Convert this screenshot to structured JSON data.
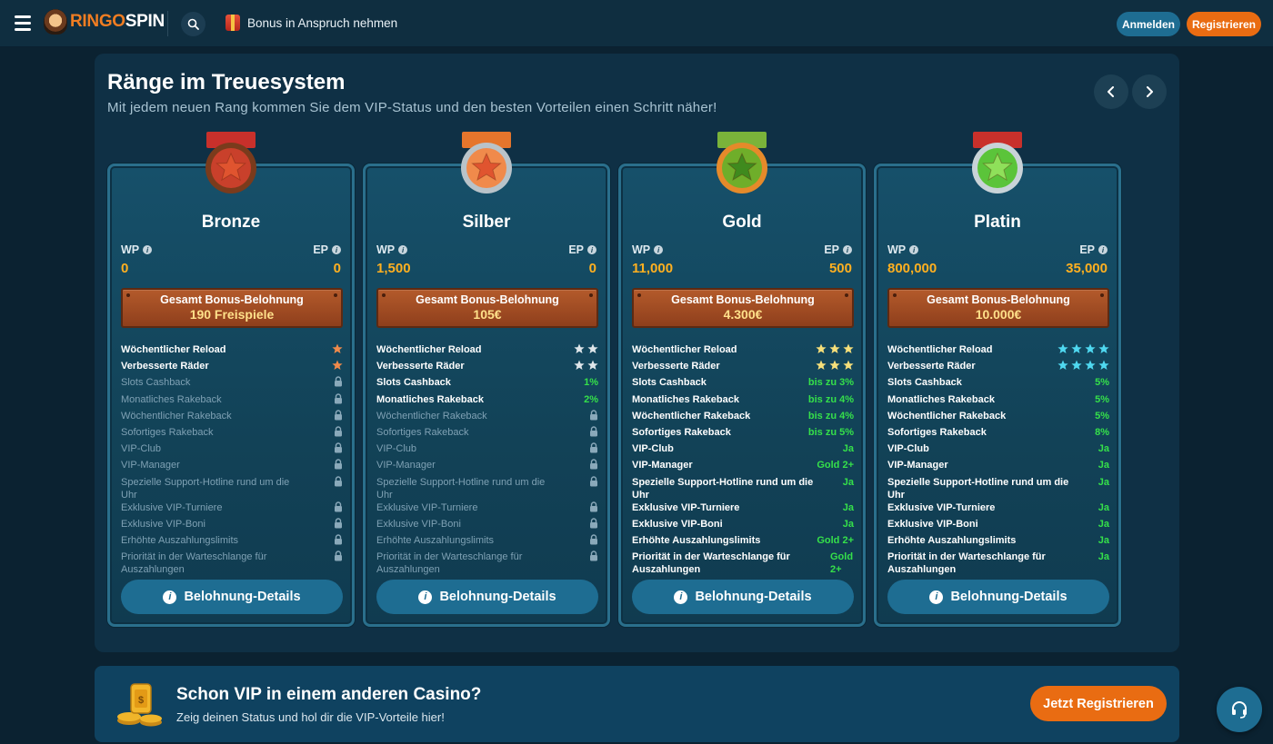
{
  "header": {
    "logo_ringo": "RINGO",
    "logo_spin": "SPIN",
    "bonus_label": "Bonus in Anspruch nehmen",
    "login_label": "Anmelden",
    "register_label": "Registrieren"
  },
  "section": {
    "title": "Ränge im Treuesystem",
    "subtitle": "Mit jedem neuen Rang kommen Sie dem VIP-Status und den besten Vorteilen einen Schritt näher!"
  },
  "cards": [
    {
      "name": "Bronze",
      "wp_label": "WP",
      "ep_label": "EP",
      "wp": "0",
      "ep": "0",
      "reward_title": "Gesamt Bonus-Belohnung",
      "reward_value": "190 Freispiele",
      "medal_color": "#c9402b",
      "star_color": "#f08a4b",
      "features": [
        {
          "name": "Wöchentlicher Reload",
          "stars": 1
        },
        {
          "name": "Verbesserte Räder",
          "stars": 1
        },
        {
          "name": "Slots Cashback",
          "locked": true
        },
        {
          "name": "Monatliches Rakeback",
          "locked": true
        },
        {
          "name": "Wöchentlicher Rakeback",
          "locked": true
        },
        {
          "name": "Sofortiges Rakeback",
          "locked": true
        },
        {
          "name": "VIP-Club",
          "locked": true
        },
        {
          "name": "VIP-Manager",
          "locked": true
        },
        {
          "name": "Spezielle Support-Hotline rund um die Uhr",
          "locked": true
        },
        {
          "name": "Exklusive VIP-Turniere",
          "locked": true
        },
        {
          "name": "Exklusive VIP-Boni",
          "locked": true
        },
        {
          "name": "Erhöhte Auszahlungslimits",
          "locked": true
        },
        {
          "name": "Priorität in der Warteschlange für Auszahlungen",
          "locked": true
        }
      ],
      "details_label": "Belohnung-Details"
    },
    {
      "name": "Silber",
      "wp_label": "WP",
      "ep_label": "EP",
      "wp": "1,500",
      "ep": "0",
      "reward_title": "Gesamt Bonus-Belohnung",
      "reward_value": "105€",
      "medal_color": "#f08a4b",
      "star_color": "#dfe6ea",
      "features": [
        {
          "name": "Wöchentlicher Reload",
          "stars": 2
        },
        {
          "name": "Verbesserte Räder",
          "stars": 2
        },
        {
          "name": "Slots Cashback",
          "value": "1%"
        },
        {
          "name": "Monatliches Rakeback",
          "value": "2%"
        },
        {
          "name": "Wöchentlicher Rakeback",
          "locked": true
        },
        {
          "name": "Sofortiges Rakeback",
          "locked": true
        },
        {
          "name": "VIP-Club",
          "locked": true
        },
        {
          "name": "VIP-Manager",
          "locked": true
        },
        {
          "name": "Spezielle Support-Hotline rund um die Uhr",
          "locked": true
        },
        {
          "name": "Exklusive VIP-Turniere",
          "locked": true
        },
        {
          "name": "Exklusive VIP-Boni",
          "locked": true
        },
        {
          "name": "Erhöhte Auszahlungslimits",
          "locked": true
        },
        {
          "name": "Priorität in der Warteschlange für Auszahlungen",
          "locked": true
        }
      ],
      "details_label": "Belohnung-Details"
    },
    {
      "name": "Gold",
      "wp_label": "WP",
      "ep_label": "EP",
      "wp": "11,000",
      "ep": "500",
      "reward_title": "Gesamt Bonus-Belohnung",
      "reward_value": "4.300€",
      "medal_color": "#6fae2a",
      "star_color": "#f6df7a",
      "features": [
        {
          "name": "Wöchentlicher Reload",
          "stars": 3
        },
        {
          "name": "Verbesserte Räder",
          "stars": 3
        },
        {
          "name": "Slots Cashback",
          "value": "bis zu 3%"
        },
        {
          "name": "Monatliches Rakeback",
          "value": "bis zu 4%"
        },
        {
          "name": "Wöchentlicher Rakeback",
          "value": "bis zu 4%"
        },
        {
          "name": "Sofortiges Rakeback",
          "value": "bis zu 5%"
        },
        {
          "name": "VIP-Club",
          "value": "Ja"
        },
        {
          "name": "VIP-Manager",
          "value": "Gold 2+"
        },
        {
          "name": "Spezielle Support-Hotline rund um die Uhr",
          "value": "Ja"
        },
        {
          "name": "Exklusive VIP-Turniere",
          "value": "Ja"
        },
        {
          "name": "Exklusive VIP-Boni",
          "value": "Ja"
        },
        {
          "name": "Erhöhte Auszahlungslimits",
          "value": "Gold 2+"
        },
        {
          "name": "Priorität in der Warteschlange für Auszahlungen",
          "value": "Gold 2+",
          "multi": true
        }
      ],
      "details_label": "Belohnung-Details"
    },
    {
      "name": "Platin",
      "wp_label": "WP",
      "ep_label": "EP",
      "wp": "800,000",
      "ep": "35,000",
      "reward_title": "Gesamt Bonus-Belohnung",
      "reward_value": "10.000€",
      "medal_color": "#5bc43a",
      "star_color": "#4fd8f0",
      "features": [
        {
          "name": "Wöchentlicher Reload",
          "stars": 4
        },
        {
          "name": "Verbesserte Räder",
          "stars": 4
        },
        {
          "name": "Slots Cashback",
          "value": "5%"
        },
        {
          "name": "Monatliches Rakeback",
          "value": "5%"
        },
        {
          "name": "Wöchentlicher Rakeback",
          "value": "5%"
        },
        {
          "name": "Sofortiges Rakeback",
          "value": "8%"
        },
        {
          "name": "VIP-Club",
          "value": "Ja"
        },
        {
          "name": "VIP-Manager",
          "value": "Ja"
        },
        {
          "name": "Spezielle Support-Hotline rund um die Uhr",
          "value": "Ja"
        },
        {
          "name": "Exklusive VIP-Turniere",
          "value": "Ja"
        },
        {
          "name": "Exklusive VIP-Boni",
          "value": "Ja"
        },
        {
          "name": "Erhöhte Auszahlungslimits",
          "value": "Ja"
        },
        {
          "name": "Priorität in der Warteschlange für Auszahlungen",
          "value": "Ja"
        }
      ],
      "details_label": "Belohnung-Details"
    }
  ],
  "vip_banner": {
    "title": "Schon VIP in einem anderen Casino?",
    "subtitle": "Zeig deinen Status und hol dir die VIP-Vorteile hier!",
    "button_label": "Jetzt Registrieren"
  },
  "icons": {
    "menu": "hamburger-icon",
    "search": "search-icon",
    "gift": "gift-icon",
    "prev": "chevron-left-icon",
    "next": "chevron-right-icon",
    "info": "info-icon",
    "lock": "lock-icon",
    "star": "star-icon",
    "support": "headset-icon"
  },
  "colors": {
    "accent_orange": "#e96c12",
    "accent_blue": "#1e6d92",
    "value_gold": "#ffb020",
    "value_green": "#35e04a"
  }
}
